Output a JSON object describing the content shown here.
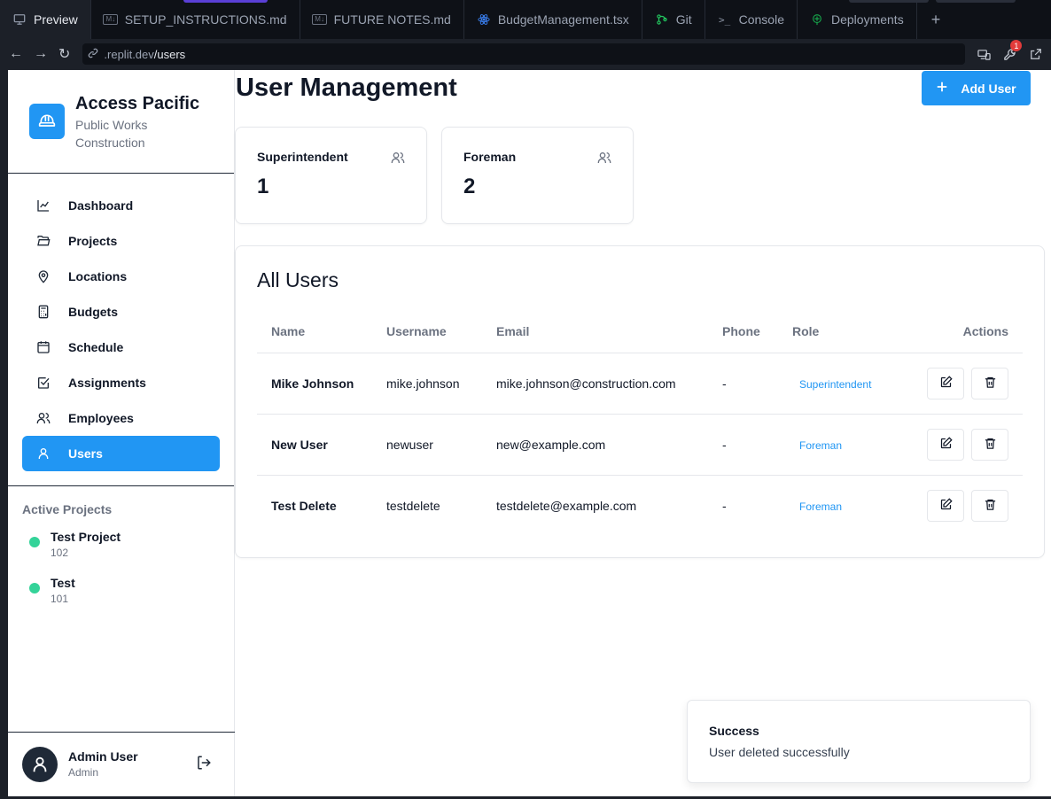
{
  "ide": {
    "tabs": [
      {
        "label": "Preview",
        "icon": "monitor-icon",
        "active": true
      },
      {
        "label": "SETUP_INSTRUCTIONS.md",
        "icon": "markdown-icon"
      },
      {
        "label": "FUTURE NOTES.md",
        "icon": "markdown-icon"
      },
      {
        "label": "BudgetManagement.tsx",
        "icon": "react-icon"
      },
      {
        "label": "Git",
        "icon": "git-icon"
      },
      {
        "label": "Console",
        "icon": "terminal-icon"
      },
      {
        "label": "Deployments",
        "icon": "deployments-icon"
      }
    ],
    "add_tab": "+",
    "url_prefix": ".replit.dev",
    "url_path": "/users",
    "notification_count": "1"
  },
  "brand": {
    "title": "Access Pacific",
    "subtitle_line1": "Public Works",
    "subtitle_line2": "Construction",
    "logo_icon": "hard-hat-icon",
    "accent": "#2196f3"
  },
  "nav": {
    "items": [
      {
        "label": "Dashboard",
        "icon": "chart-line-icon"
      },
      {
        "label": "Projects",
        "icon": "folder-open-icon"
      },
      {
        "label": "Locations",
        "icon": "map-pin-icon"
      },
      {
        "label": "Budgets",
        "icon": "calculator-icon"
      },
      {
        "label": "Schedule",
        "icon": "calendar-icon"
      },
      {
        "label": "Assignments",
        "icon": "checkbox-icon"
      },
      {
        "label": "Employees",
        "icon": "users-icon"
      },
      {
        "label": "Users",
        "icon": "user-icon",
        "active": true
      }
    ]
  },
  "active_projects": {
    "heading": "Active Projects",
    "items": [
      {
        "name": "Test Project",
        "number": "102"
      },
      {
        "name": "Test",
        "number": "101"
      }
    ],
    "dot_color": "#34d399"
  },
  "current_user": {
    "name": "Admin User",
    "role": "Admin"
  },
  "page": {
    "title": "User Management",
    "add_button": "Add User"
  },
  "stats": [
    {
      "label": "Superintendent",
      "value": "1"
    },
    {
      "label": "Foreman",
      "value": "2"
    }
  ],
  "users_table": {
    "title": "All Users",
    "columns": [
      "Name",
      "Username",
      "Email",
      "Phone",
      "Role",
      "Actions"
    ],
    "rows": [
      {
        "name": "Mike Johnson",
        "username": "mike.johnson",
        "email": "mike.johnson@construction.com",
        "phone": "-",
        "role": "Superintendent"
      },
      {
        "name": "New User",
        "username": "newuser",
        "email": "new@example.com",
        "phone": "-",
        "role": "Foreman"
      },
      {
        "name": "Test Delete",
        "username": "testdelete",
        "email": "testdelete@example.com",
        "phone": "-",
        "role": "Foreman"
      }
    ]
  },
  "toast": {
    "title": "Success",
    "message": "User deleted successfully"
  }
}
